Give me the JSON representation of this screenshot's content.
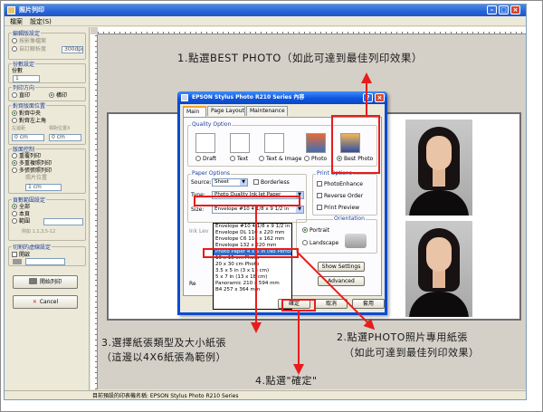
{
  "app": {
    "title": "照片列印",
    "menu": [
      "檔案",
      "設定(S)"
    ]
  },
  "panel": {
    "layout_group": "編輯版設定",
    "layout_options": [
      "按影像檔案",
      "自訂解析度"
    ],
    "layout_value": "300dpi",
    "copies_group": "份數設定",
    "copies_label": "份數",
    "copies_value": "1",
    "orientation_group": "列印方向",
    "orientation_options": [
      "直印",
      "橫印"
    ],
    "position_group": "對齊版面位置",
    "position_options": [
      "對齊中央",
      "對齊左上角"
    ],
    "offset_labels": [
      "左邊距",
      "上邊距",
      "相對位置X",
      "相對位置Y"
    ],
    "offset_values": [
      "0 cm",
      "0 cm",
      "0 cm",
      "0 cm"
    ],
    "photo_group": "版面控制",
    "photo_options": [
      "重覆列印",
      "多重複照列印",
      "多張張照列印"
    ],
    "photo_field_label": "照片位置",
    "photo_value": "1 cm",
    "range_group": "頁數範圍設定",
    "range_options": [
      "全部",
      "本頁",
      "範圍"
    ],
    "range_hint": "例如 1,1,3,5-12",
    "cut_group": "切割的虛線設定",
    "cut_option": "開啟",
    "print_button": "開始列印",
    "cancel_button": "Cancel"
  },
  "status": {
    "text": "目前預設的印表機名稱: EPSON Stylus Photo R210 Series"
  },
  "dialog": {
    "title": "EPSON Stylus Photo R210 Series 內容",
    "tabs": [
      "Main",
      "Page Layout",
      "Maintenance"
    ],
    "quality_group": "Quality Option",
    "quality_options": [
      "Draft",
      "Text",
      "Text & Image",
      "Photo",
      "Best Photo"
    ],
    "paper_group": "Paper Options",
    "source_label": "Source:",
    "source_value": "Sheet",
    "borderless_label": "Borderless",
    "type_label": "Type:",
    "type_value": "Photo Quality Ink Jet Paper",
    "size_label": "Size:",
    "size_value": "Envelope #10 4 1/8 x 9 1/2 in",
    "size_options": [
      "Envelope #10 4 1/8 x 9 1/2 in",
      "Envelope DL 110 x 220 mm",
      "Envelope C6 114 x 162 mm",
      "Envelope 132 x 220 mm",
      "Photo Paper 4 x 6 in (No Perforation)",
      "10 x 15 cm Photo",
      "20 x 30 cm Photo",
      "3.5 x 5 in (3 x 13 cm)",
      "5 x 7 in (13 x 18 cm)",
      "Panoramic 210 x 594 mm",
      "B4 257 x 364 mm"
    ],
    "size_selected_index": 4,
    "ink_label": "Ink Lev",
    "print_options_group": "Print Options",
    "print_options": [
      "PhotoEnhance",
      "Reverse Order",
      "Print Preview"
    ],
    "orientation_group": "Orientation",
    "orientation_options": [
      "Portrait",
      "Landscape"
    ],
    "show_settings_button": "Show Settings",
    "advanced_button": "Advanced",
    "reset_label": "Re",
    "ok_button": "確定",
    "cancel_button": "取消",
    "apply_button": "套用"
  },
  "annotations": {
    "step1": "1.點選BEST PHOTO（如此可達到最佳列印效果）",
    "step2_line1": "2.點選PHOTO照片專用紙張",
    "step2_line2": "（如此可達到最佳列印效果）",
    "step3_line1": "3.選擇紙張類型及大小紙張",
    "step3_line2": "（這邊以4X6紙張為範例）",
    "step4": "4.點選\"確定\"",
    "color": "#e81c1c"
  }
}
